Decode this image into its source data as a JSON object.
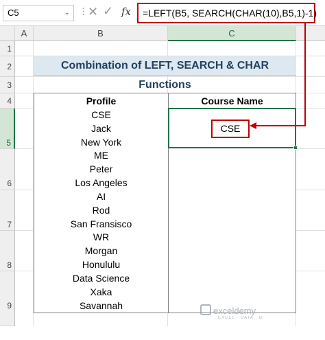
{
  "formula_bar": {
    "name_box": "C5",
    "dots": "⋮",
    "cancel_icon": "✕",
    "enter_icon": "✓",
    "fx_label": "fx",
    "formula": "=LEFT(B5, SEARCH(CHAR(10),B5,1)-1)"
  },
  "columns": [
    "A",
    "B",
    "C"
  ],
  "rows": [
    "1",
    "2",
    "3",
    "4",
    "5",
    "6",
    "7",
    "8",
    "9"
  ],
  "title": "Combination of LEFT, SEARCH & CHAR Functions",
  "table": {
    "headers": [
      "Profile",
      "Course Name"
    ],
    "rows": [
      {
        "profile": [
          "CSE",
          "Jack",
          "New York"
        ],
        "course": "CSE"
      },
      {
        "profile": [
          "ME",
          "Peter",
          "Los Angeles"
        ],
        "course": ""
      },
      {
        "profile": [
          "AI",
          "Rod",
          "San Fransisco"
        ],
        "course": ""
      },
      {
        "profile": [
          "WR",
          "Morgan",
          "Honululu"
        ],
        "course": ""
      },
      {
        "profile": [
          "Data Science",
          "Xaka",
          "Savannah"
        ],
        "course": ""
      }
    ]
  },
  "annotation_color": "#c00000",
  "accent_color": "#217346",
  "watermark": {
    "name": "exceldemy",
    "sub": "EXCEL · DATA · BI"
  }
}
